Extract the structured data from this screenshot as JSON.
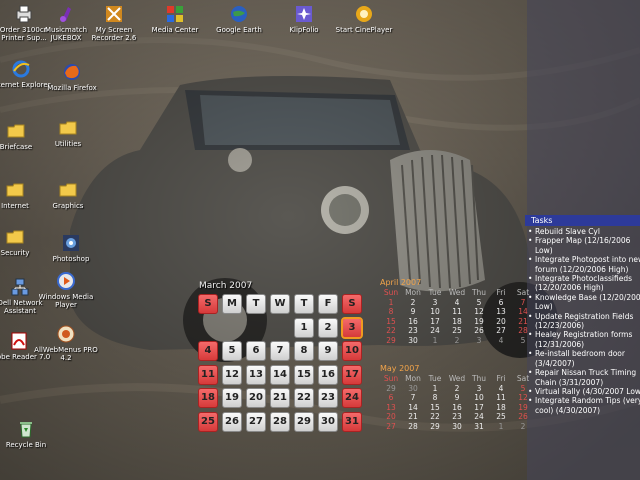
{
  "desktop_icons": [
    {
      "id": "order",
      "name": "printer-icon",
      "label": "Order 3100cn Printer Sup..."
    },
    {
      "id": "musicmatch",
      "name": "musicmatch-icon",
      "label": "Musicmatch JUKEBOX"
    },
    {
      "id": "screenrec",
      "name": "screen-recorder-icon",
      "label": "My Screen Recorder 2.6"
    },
    {
      "id": "mediacenter",
      "name": "media-center-icon",
      "label": "Media Center"
    },
    {
      "id": "googleearth",
      "name": "google-earth-icon",
      "label": "Google Earth"
    },
    {
      "id": "klipfolio",
      "name": "klipfolio-icon",
      "label": "KlipFolio"
    },
    {
      "id": "cineplayer",
      "name": "cineplayer-icon",
      "label": "Start CinePlayer"
    },
    {
      "id": "ie",
      "name": "internet-explorer-icon",
      "label": "Internet Explorer"
    },
    {
      "id": "firefox",
      "name": "firefox-icon",
      "label": "Mozilla Firefox"
    },
    {
      "id": "briefcase",
      "name": "briefcase-folder-icon",
      "label": "Briefcase"
    },
    {
      "id": "utilities",
      "name": "utilities-folder-icon",
      "label": "Utilities"
    },
    {
      "id": "internet",
      "name": "internet-folder-icon",
      "label": "Internet"
    },
    {
      "id": "graphics",
      "name": "graphics-folder-icon",
      "label": "Graphics"
    },
    {
      "id": "security",
      "name": "security-folder-icon",
      "label": "Security"
    },
    {
      "id": "photoshop",
      "name": "photoshop-icon",
      "label": "Photoshop"
    },
    {
      "id": "dellnet",
      "name": "dell-network-assistant-icon",
      "label": "Dell Network Assistant"
    },
    {
      "id": "wmp",
      "name": "windows-media-player-icon",
      "label": "Windows Media Player"
    },
    {
      "id": "adobereader",
      "name": "adobe-reader-icon",
      "label": "Adobe Reader 7.0"
    },
    {
      "id": "allwebmenus",
      "name": "allwebmenus-icon",
      "label": "AllWebMenus PRO 4.2"
    },
    {
      "id": "recycle",
      "name": "recycle-bin-icon",
      "label": "Recycle Bin"
    }
  ],
  "big_calendar": {
    "title": "March 2007",
    "day_headers": [
      "S",
      "M",
      "T",
      "W",
      "T",
      "F",
      "S"
    ],
    "weeks": [
      [
        "",
        "",
        "",
        "",
        "1",
        "2",
        "3"
      ],
      [
        "4",
        "5",
        "6",
        "7",
        "8",
        "9",
        "10"
      ],
      [
        "11",
        "12",
        "13",
        "14",
        "15",
        "16",
        "17"
      ],
      [
        "18",
        "19",
        "20",
        "21",
        "22",
        "23",
        "24"
      ],
      [
        "25",
        "26",
        "27",
        "28",
        "29",
        "30",
        "31"
      ]
    ],
    "today": "3"
  },
  "april_calendar": {
    "title": "April 2007",
    "headers": [
      "Sun",
      "Mon",
      "Tue",
      "Wed",
      "Thu",
      "Fri",
      "Sat"
    ],
    "rows": [
      [
        "1",
        "2",
        "3",
        "4",
        "5",
        "6",
        "7"
      ],
      [
        "8",
        "9",
        "10",
        "11",
        "12",
        "13",
        "14"
      ],
      [
        "15",
        "16",
        "17",
        "18",
        "19",
        "20",
        "21"
      ],
      [
        "22",
        "23",
        "24",
        "25",
        "26",
        "27",
        "28"
      ],
      [
        "29",
        "30",
        "1",
        "2",
        "3",
        "4",
        "5"
      ]
    ]
  },
  "may_calendar": {
    "title": "May 2007",
    "headers": [
      "Sun",
      "Mon",
      "Tue",
      "Wed",
      "Thu",
      "Fri",
      "Sat"
    ],
    "rows": [
      [
        "29",
        "30",
        "1",
        "2",
        "3",
        "4",
        "5"
      ],
      [
        "6",
        "7",
        "8",
        "9",
        "10",
        "11",
        "12"
      ],
      [
        "13",
        "14",
        "15",
        "16",
        "17",
        "18",
        "19"
      ],
      [
        "20",
        "21",
        "22",
        "23",
        "24",
        "25",
        "26"
      ],
      [
        "27",
        "28",
        "29",
        "30",
        "31",
        "1",
        "2"
      ]
    ]
  },
  "tasks": {
    "title": "Tasks",
    "items": [
      "Rebuild Slave Cyl",
      "Frapper Map (12/16/2006 Low)",
      "Integrate Photopost into new forum (12/20/2006 High)",
      "Integrate Photoclassifieds (12/20/2006 High)",
      "Knowledge Base (12/20/2006 Low)",
      "Update Registration Fields (12/23/2006)",
      "Healey Registration forms (12/31/2006)",
      "Re-install bedroom door (3/4/2007)",
      "Repair Nissan Truck Timing Chain (3/31/2007)",
      "Virtual Rally (4/30/2007 Low)",
      "Integrate Random Tips (very cool) (4/30/2007)"
    ]
  },
  "colors": {
    "calendar_weekend": "#e04848",
    "calendar_weekday": "#e8e8e8",
    "small_cal_title": "#f2a44a",
    "tasks_title_bg": "#2d3a9a"
  }
}
